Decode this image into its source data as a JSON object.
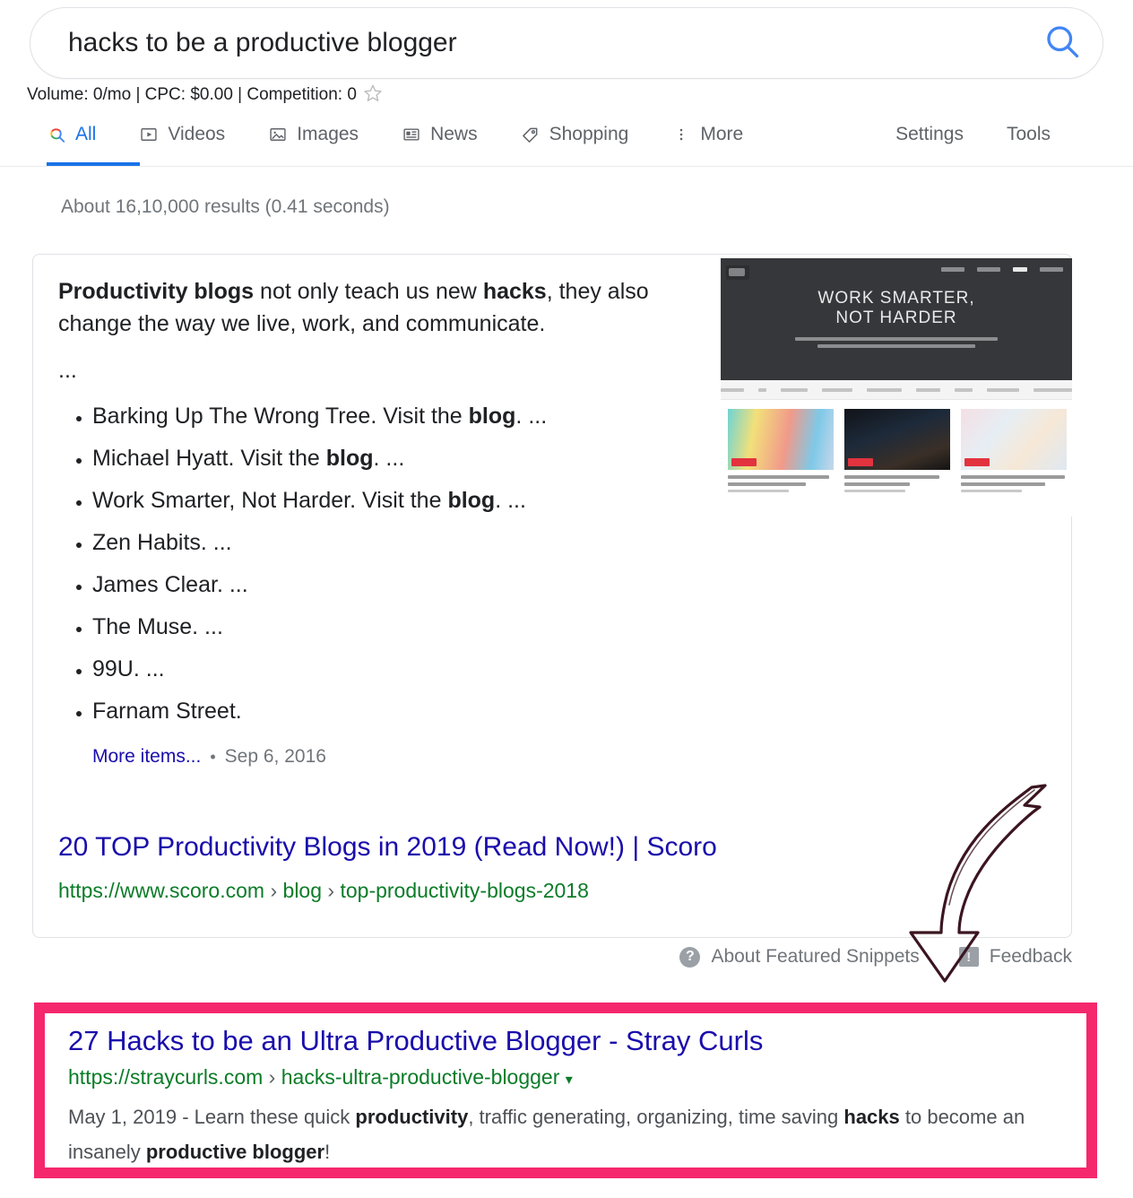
{
  "search": {
    "query": "hacks to be a productive blogger",
    "search_icon": "search-icon"
  },
  "keyword_metrics": {
    "text": "Volume: 0/mo | CPC: $0.00 | Competition: 0",
    "star_icon": "star-icon"
  },
  "nav": {
    "tabs": [
      {
        "label": "All",
        "icon": "google-search-icon",
        "active": true
      },
      {
        "label": "Videos",
        "icon": "video-icon",
        "active": false
      },
      {
        "label": "Images",
        "icon": "image-icon",
        "active": false
      },
      {
        "label": "News",
        "icon": "news-icon",
        "active": false
      },
      {
        "label": "Shopping",
        "icon": "tag-icon",
        "active": false
      },
      {
        "label": "More",
        "icon": "more-vertical-icon",
        "active": false
      }
    ],
    "settings_label": "Settings",
    "tools_label": "Tools",
    "active_color": "#1a73e8"
  },
  "result_stats": "About 16,10,000 results (0.41 seconds)",
  "featured_snippet": {
    "paragraph_pre": "Productivity blogs",
    "paragraph_mid": " not only teach us new ",
    "paragraph_bold2": "hacks",
    "paragraph_post": ", they also change the way we live, work, and communicate.",
    "ellipsis": "...",
    "list": [
      {
        "text": "Barking Up The Wrong Tree. Visit the ",
        "bold": "blog",
        "tail": ". ..."
      },
      {
        "text": "Michael Hyatt. Visit the ",
        "bold": "blog",
        "tail": ". ..."
      },
      {
        "text": "Work Smarter, Not Harder. Visit the ",
        "bold": "blog",
        "tail": ". ..."
      },
      {
        "text": "Zen Habits. ...",
        "bold": "",
        "tail": ""
      },
      {
        "text": "James Clear. ...",
        "bold": "",
        "tail": ""
      },
      {
        "text": "The Muse. ...",
        "bold": "",
        "tail": ""
      },
      {
        "text": "99U. ...",
        "bold": "",
        "tail": ""
      },
      {
        "text": "Farnam Street.",
        "bold": "",
        "tail": ""
      }
    ],
    "more_items_label": "More items...",
    "bullet_sep": "•",
    "date": "Sep 6, 2016",
    "title": "20 TOP Productivity Blogs in 2019 (Read Now!) | Scoro",
    "url_domain": "https://www.scoro.com",
    "url_sep1": "›",
    "url_part1": "blog",
    "url_sep2": "›",
    "url_part2": "top-productivity-blogs-2018",
    "thumbnail": {
      "hero_line1": "WORK SMARTER,",
      "hero_line2": "NOT HARDER"
    }
  },
  "snippet_footer": {
    "about_label": "About Featured Snippets",
    "about_icon": "question-mark-icon",
    "feedback_label": "Feedback",
    "feedback_icon": "feedback-icon"
  },
  "annotation": {
    "arrow_icon": "hand-drawn-curved-arrow-icon",
    "arrow_color": "#3d1420"
  },
  "highlighted_result": {
    "border_color": "#f5276d",
    "title": "27 Hacks to be an Ultra Productive Blogger - Stray Curls",
    "url_domain": "https://straycurls.com",
    "url_sep": "›",
    "url_path": "hacks-ultra-productive-blogger",
    "url_caret": "▾",
    "desc_date": "May 1, 2019",
    "desc_dash": " - ",
    "desc_p1": "Learn these quick ",
    "desc_b1": "productivity",
    "desc_p2": ", traffic generating, organizing, time saving ",
    "desc_b2": "hacks",
    "desc_p3": " to become an insanely ",
    "desc_b3": "productive blogger",
    "desc_p4": "!"
  }
}
